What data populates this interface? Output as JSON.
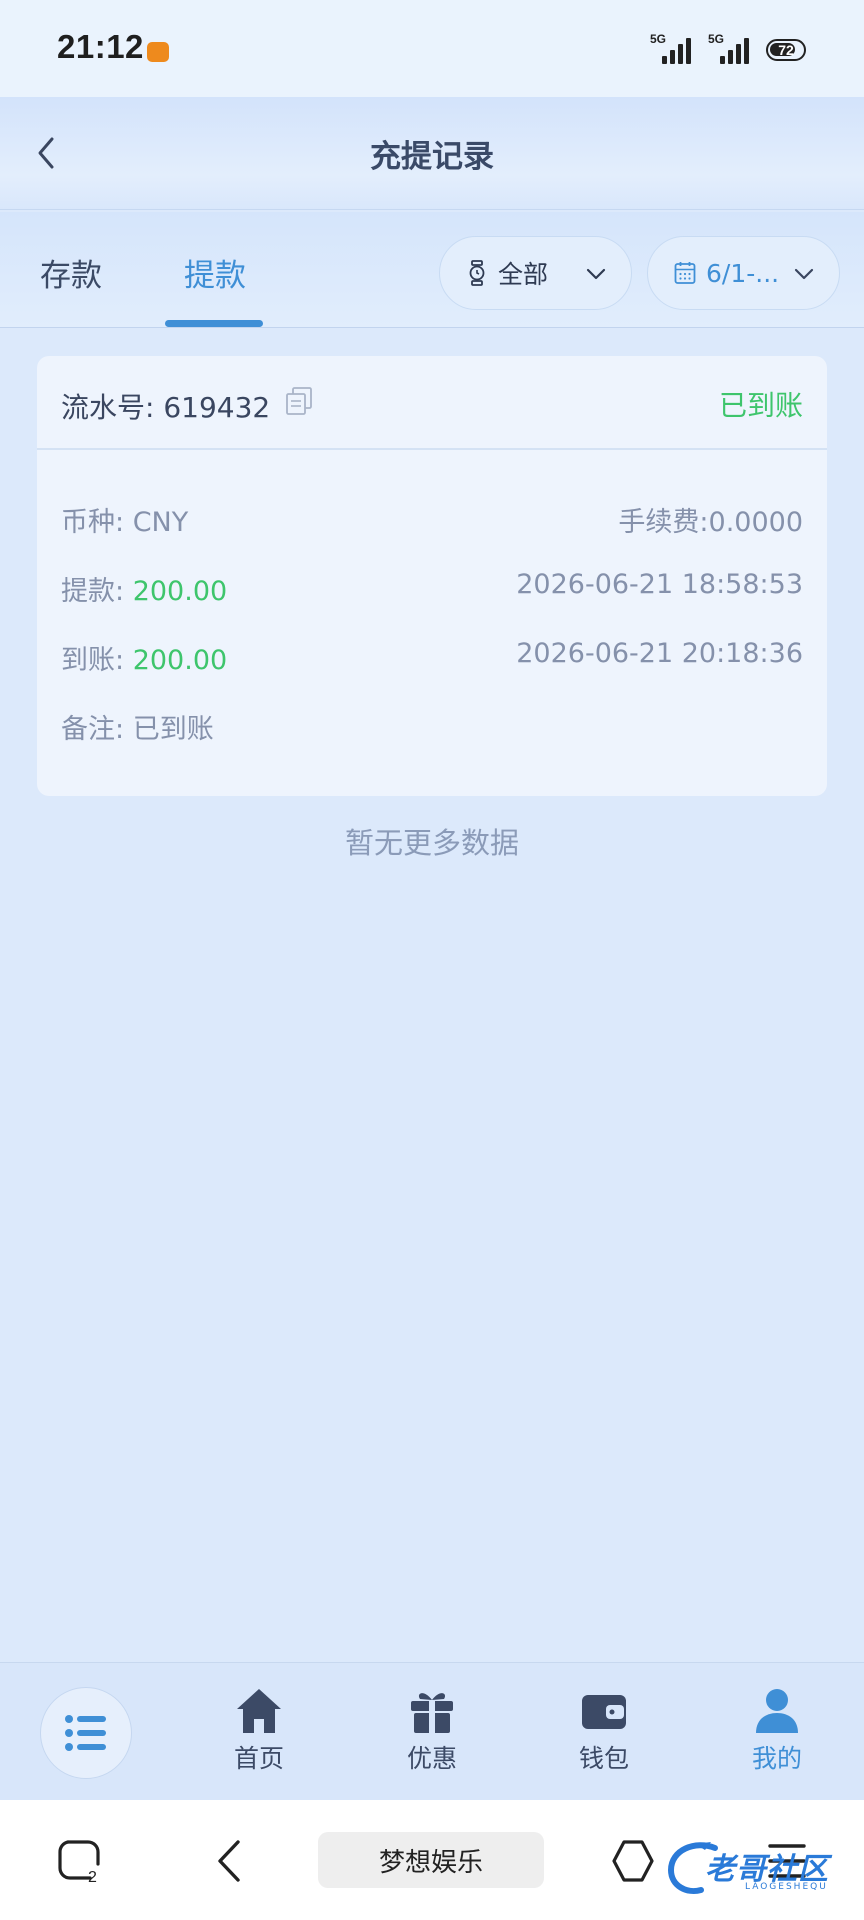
{
  "status_bar": {
    "time": "21:12",
    "network_1": "5G",
    "network_2": "5G",
    "battery": "72"
  },
  "header": {
    "title": "充提记录",
    "back_icon": "chevron-left-icon"
  },
  "tabs": [
    {
      "label": "存款",
      "active": false
    },
    {
      "label": "提款",
      "active": true
    }
  ],
  "filters": {
    "type": {
      "label": "全部",
      "icon": "watch-icon"
    },
    "date": {
      "label": "6/1-...",
      "icon": "calendar-icon"
    }
  },
  "record": {
    "serial": "流水号: 619432",
    "status": "已到账",
    "currency_label": "币种:",
    "currency_value": "CNY",
    "fee": "手续费:0.0000",
    "withdraw_label": "提款:",
    "withdraw_amount": "200.00",
    "withdraw_time": "2026-06-21 18:58:53",
    "arrival_label": "到账:",
    "arrival_amount": "200.00",
    "arrival_time": "2026-06-21 20:18:36",
    "remark_label": "备注:",
    "remark_value": "已到账"
  },
  "empty_note": "暂无更多数据",
  "bottom_nav": [
    {
      "label": "首页",
      "icon": "home-icon"
    },
    {
      "label": "优惠",
      "icon": "gift-icon"
    },
    {
      "label": "钱包",
      "icon": "wallet-icon"
    },
    {
      "label": "我的",
      "icon": "user-icon",
      "active": true
    }
  ],
  "system_bar": {
    "app_label": "梦想娱乐",
    "recent_count": "2"
  },
  "watermark": {
    "text": "老哥社区",
    "sub": "LAOGESHEQU"
  },
  "colors": {
    "accent": "#3f8fd6",
    "success": "#3ec56c",
    "page_bg": "#dce9fb"
  }
}
